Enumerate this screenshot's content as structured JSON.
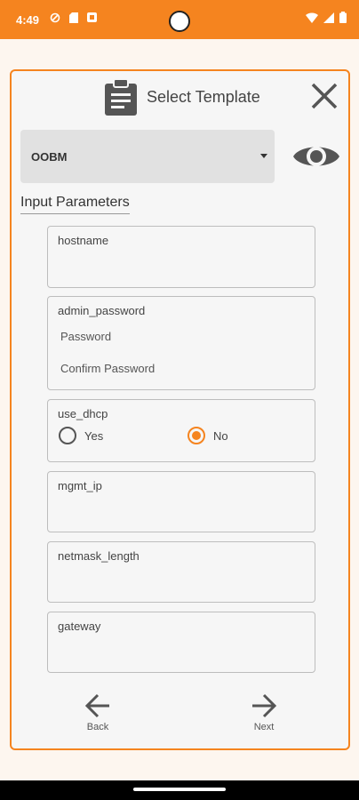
{
  "status_bar": {
    "time": "4:49"
  },
  "dialog": {
    "title": "Select Template",
    "template_select": {
      "value": "OOBM"
    },
    "section_label": "Input Parameters",
    "params": {
      "hostname": {
        "label": "hostname"
      },
      "admin_password": {
        "label": "admin_password",
        "password_placeholder": "Password",
        "confirm_placeholder": "Confirm Password"
      },
      "use_dhcp": {
        "label": "use_dhcp",
        "yes_label": "Yes",
        "no_label": "No",
        "selected": "No"
      },
      "mgmt_ip": {
        "label": "mgmt_ip"
      },
      "netmask_length": {
        "label": "netmask_length"
      },
      "gateway": {
        "label": "gateway"
      }
    },
    "nav": {
      "back_label": "Back",
      "next_label": "Next"
    }
  },
  "colors": {
    "accent": "#f5841f",
    "dialog_bg": "#f6f6f6",
    "select_bg": "#e1e1e1"
  }
}
